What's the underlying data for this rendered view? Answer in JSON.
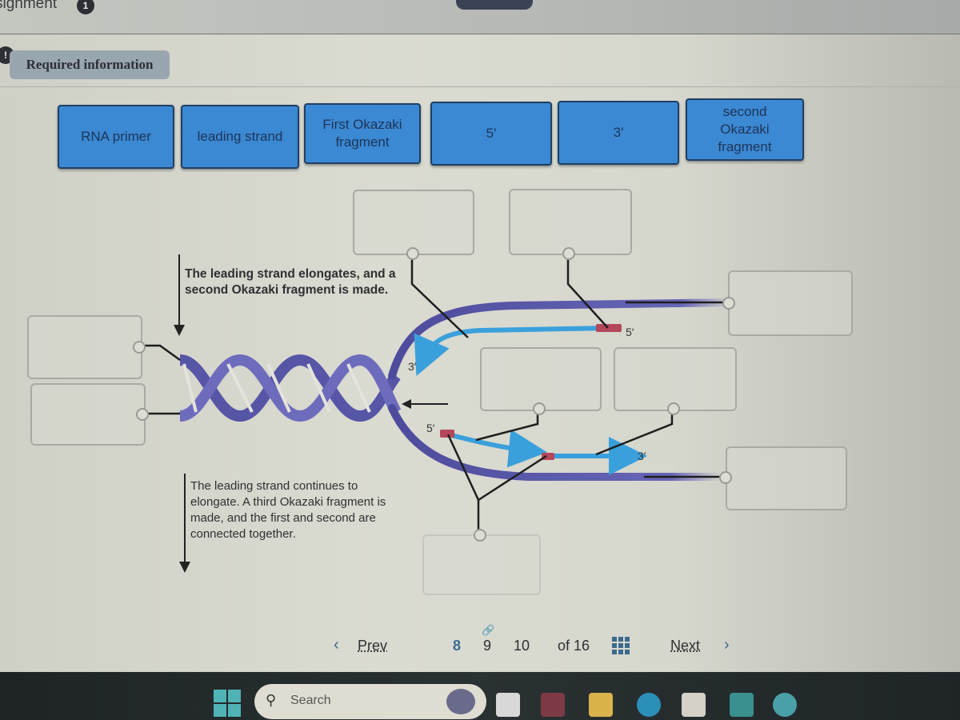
{
  "header": {
    "assignment_label": "signment",
    "assignment_badge": "1",
    "required_alert": "!",
    "required_label": "Required information"
  },
  "label_tiles": [
    {
      "id": "rna-primer",
      "label": "RNA primer"
    },
    {
      "id": "leading-strand",
      "label": "leading strand"
    },
    {
      "id": "first-okazaki",
      "label": "First Okazaki fragment"
    },
    {
      "id": "five-prime",
      "label": "5'"
    },
    {
      "id": "three-prime",
      "label": "3'"
    },
    {
      "id": "second-okazaki",
      "label": "second Okazaki fragment"
    }
  ],
  "diagram": {
    "caption_top": "The leading strand elongates, and a second Okazaki fragment is made.",
    "caption_bottom": "The leading strand continues to elongate. A third Okazaki fragment is made, and the first and second are connected together.",
    "strand_end_labels": {
      "upper_3": "3'",
      "upper_5": "5'",
      "lower_5": "5'",
      "lower_3": "3'"
    },
    "drop_targets_count": 9,
    "colors": {
      "helix": "#5b5aa8",
      "new_strand": "#3aa0dc",
      "primer": "#b5475a",
      "tile": "#3b88d3"
    }
  },
  "pagination": {
    "prev_label": "Prev",
    "pages": [
      "8",
      "9",
      "10"
    ],
    "current_page": "8",
    "of_label": "of 16",
    "next_label": "Next"
  },
  "taskbar": {
    "search_placeholder": "Search"
  }
}
